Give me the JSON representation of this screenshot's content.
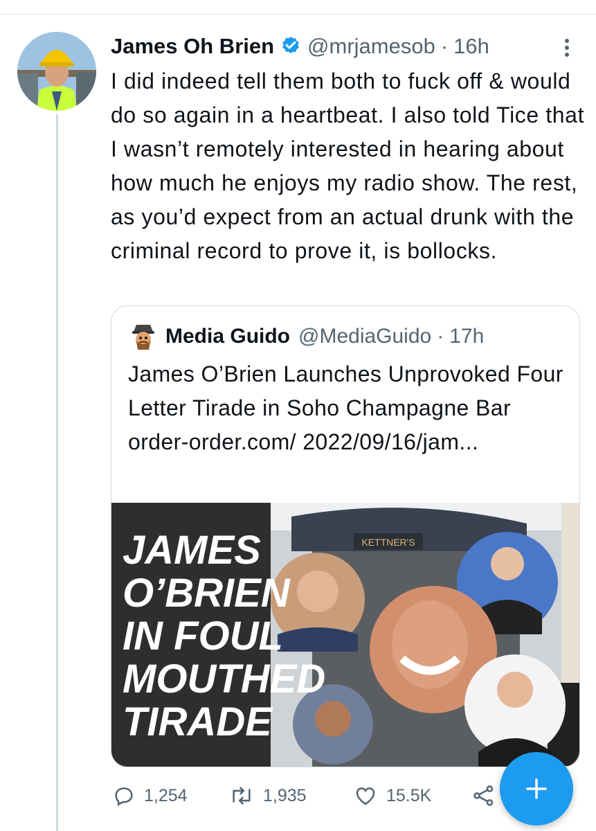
{
  "tweet": {
    "author_name": "James Oh Brien",
    "handle": "@mrjamesob",
    "separator": "·",
    "time": "16h",
    "text": "I did indeed tell them both to fuck off & would do so again in a heartbeat. I also told Tice that I wasn’t remotely interested in hearing about how much he enjoys my radio show. The rest, as you’d expect from an actual drunk with the criminal record to prove it, is bollocks."
  },
  "quote": {
    "author_name": "Media Guido",
    "handle": "@MediaGuido",
    "separator": "·",
    "time": "17h",
    "text": "James O’Brien Launches Unprovoked Four Letter Tirade in Soho Champagne Bar order-order.com/ 2022/09/16/jam...",
    "image": {
      "headline_lines": [
        "JAMES",
        "O’BRIEN",
        "IN FOUL",
        "MOUTHED",
        "TIRADE"
      ],
      "sign_text": "KETTNER'S"
    }
  },
  "actions": {
    "replies": "1,254",
    "retweets": "1,935",
    "likes": "15.5K"
  },
  "icons": {
    "verified": "verified-badge-icon",
    "more": "more-vertical-icon",
    "reply": "reply-icon",
    "retweet": "retweet-icon",
    "like": "heart-icon",
    "share": "share-icon",
    "compose": "compose-plus-icon"
  },
  "colors": {
    "accent": "#1d9bf0",
    "text": "#0f1419",
    "secondary": "#536471",
    "image_headline": "#ffffff",
    "image_bg": "#2b2b2b"
  }
}
